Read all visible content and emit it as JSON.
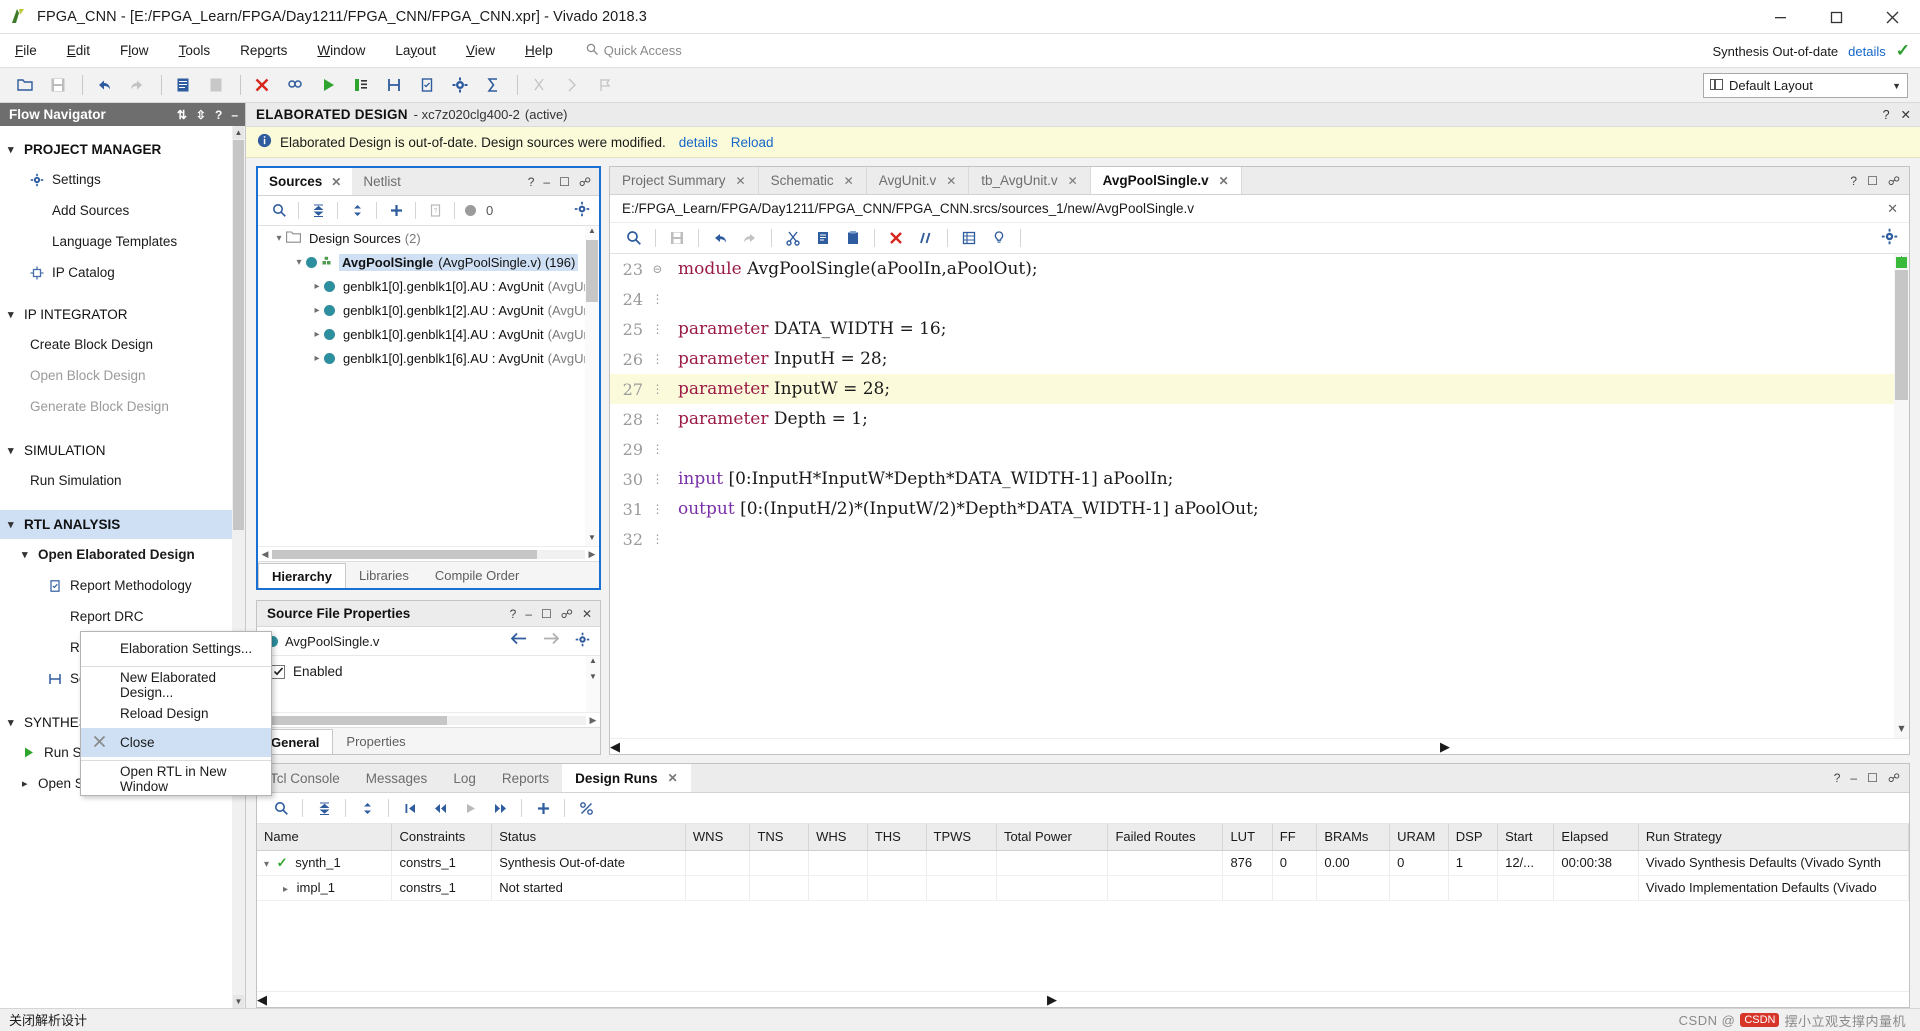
{
  "titlebar": {
    "title": "FPGA_CNN - [E:/FPGA_Learn/FPGA/Day1211/FPGA_CNN/FPGA_CNN.xpr] - Vivado 2018.3",
    "minimize": "minimize-icon",
    "maximize": "maximize-icon",
    "close": "close-icon"
  },
  "menubar": {
    "items": [
      "File",
      "Edit",
      "Flow",
      "Tools",
      "Reports",
      "Window",
      "Layout",
      "View",
      "Help"
    ],
    "quick_access_placeholder": "Quick Access",
    "sync_status": "Synthesis Out-of-date",
    "details_label": "details"
  },
  "toolbar": {
    "layout_value": "Default Layout"
  },
  "flow_navigator": {
    "header": "Flow Navigator",
    "sections": [
      {
        "label": "PROJECT MANAGER",
        "items": [
          {
            "label": "Settings",
            "icon": "gear-icon",
            "dim": false
          },
          {
            "label": "Add Sources",
            "icon": "",
            "dim": false
          },
          {
            "label": "Language Templates",
            "icon": "",
            "dim": false
          },
          {
            "label": "IP Catalog",
            "icon": "ip-icon",
            "dim": false
          }
        ]
      },
      {
        "label": "IP INTEGRATOR",
        "items": [
          {
            "label": "Create Block Design",
            "icon": "",
            "dim": false
          },
          {
            "label": "Open Block Design",
            "icon": "",
            "dim": true
          },
          {
            "label": "Generate Block Design",
            "icon": "",
            "dim": true
          }
        ]
      },
      {
        "label": "SIMULATION",
        "items": [
          {
            "label": "Run Simulation",
            "icon": "",
            "dim": false
          }
        ]
      },
      {
        "label": "RTL ANALYSIS",
        "active": true,
        "items": [
          {
            "label": "Open Elaborated Design",
            "icon": "",
            "dim": false,
            "bold": true
          },
          {
            "label": "Report Methodology",
            "icon": "clipboard-icon",
            "dim": false
          },
          {
            "label": "Report DRC",
            "icon": "",
            "dim": false
          },
          {
            "label": "Report Noise",
            "icon": "",
            "dim": false
          },
          {
            "label": "Schematic",
            "icon": "schematic-icon",
            "dim": false
          }
        ]
      },
      {
        "label": "SYNTHESIS",
        "items": [
          {
            "label": "Run Synthesis",
            "icon": "run-icon",
            "dim": false
          },
          {
            "label": "Open Synthesized Design",
            "icon": "",
            "dim": false
          }
        ]
      }
    ]
  },
  "context_menu": {
    "items": [
      {
        "label": "Elaboration Settings...",
        "icon": "",
        "selected": false,
        "sep_after": true
      },
      {
        "label": "New Elaborated Design...",
        "icon": "",
        "selected": false
      },
      {
        "label": "Reload Design",
        "icon": "",
        "selected": false
      },
      {
        "label": "Close",
        "icon": "close-x-icon",
        "selected": true,
        "sep_after": true
      },
      {
        "label": "Open RTL in New Window",
        "icon": "",
        "selected": false
      }
    ]
  },
  "design_header": {
    "title": "ELABORATED DESIGN",
    "subtitle": "- xc7z020clg400-2",
    "active": "(active)"
  },
  "warning_bar": {
    "message": "Elaborated Design is out-of-date. Design sources were modified.",
    "details_link": "details",
    "reload_link": "Reload"
  },
  "sources_panel": {
    "tabs": [
      {
        "label": "Sources",
        "active": true,
        "closable": true
      },
      {
        "label": "Netlist",
        "active": false,
        "closable": false
      }
    ],
    "toolbar_count": "0",
    "tree": [
      {
        "indent": 0,
        "chev": "v",
        "icon": "folder-icon",
        "name": "Design Sources",
        "meta": "(2)",
        "selected": false,
        "bold": false
      },
      {
        "indent": 1,
        "chev": "v",
        "icon": "module-icon",
        "name": "AvgPoolSingle",
        "meta": "(AvgPoolSingle.v) (196)",
        "selected": true,
        "bold": true
      },
      {
        "indent": 2,
        "chev": ">",
        "icon": "dot-icon",
        "name": "genblk1[0].genblk1[0].AU : AvgUnit",
        "meta": "(AvgUnit",
        "selected": false,
        "bold": false
      },
      {
        "indent": 2,
        "chev": ">",
        "icon": "dot-icon",
        "name": "genblk1[0].genblk1[2].AU : AvgUnit",
        "meta": "(AvgUnit",
        "selected": false,
        "bold": false
      },
      {
        "indent": 2,
        "chev": ">",
        "icon": "dot-icon",
        "name": "genblk1[0].genblk1[4].AU : AvgUnit",
        "meta": "(AvgUnit",
        "selected": false,
        "bold": false
      },
      {
        "indent": 2,
        "chev": ">",
        "icon": "dot-icon",
        "name": "genblk1[0].genblk1[6].AU : AvgUnit",
        "meta": "(AvgUnit",
        "selected": false,
        "bold": false
      }
    ],
    "bottom_tabs": [
      {
        "label": "Hierarchy",
        "active": true
      },
      {
        "label": "Libraries",
        "active": false
      },
      {
        "label": "Compile Order",
        "active": false
      }
    ]
  },
  "source_file_properties": {
    "title": "Source File Properties",
    "file_name": "AvgPoolSingle.v",
    "enabled_label": "Enabled",
    "enabled_checked": true,
    "tabs": [
      {
        "label": "General",
        "active": true
      },
      {
        "label": "Properties",
        "active": false
      }
    ]
  },
  "editor": {
    "tabs": [
      {
        "label": "Project Summary",
        "active": false,
        "closable": true
      },
      {
        "label": "Schematic",
        "active": false,
        "closable": true
      },
      {
        "label": "AvgUnit.v",
        "active": false,
        "closable": true
      },
      {
        "label": "tb_AvgUnit.v",
        "active": false,
        "closable": true
      },
      {
        "label": "AvgPoolSingle.v",
        "active": true,
        "closable": true
      }
    ],
    "file_path": "E:/FPGA_Learn/FPGA/Day1211/FPGA_CNN/FPGA_CNN.srcs/sources_1/new/AvgPoolSingle.v",
    "lines": [
      {
        "num": "23",
        "fold": true,
        "highlight": false,
        "tokens": [
          {
            "t": "module",
            "c": "kw"
          },
          {
            "t": " AvgPoolSingle(aPoolIn,aPoolOut);",
            "c": "idf"
          }
        ]
      },
      {
        "num": "24",
        "fold": false,
        "highlight": false,
        "tokens": []
      },
      {
        "num": "25",
        "fold": false,
        "highlight": false,
        "tokens": [
          {
            "t": "parameter",
            "c": "kw"
          },
          {
            "t": " DATA_WIDTH = 16;",
            "c": "idf"
          }
        ]
      },
      {
        "num": "26",
        "fold": false,
        "highlight": false,
        "tokens": [
          {
            "t": "parameter",
            "c": "kw"
          },
          {
            "t": " InputH = 28;",
            "c": "idf"
          }
        ]
      },
      {
        "num": "27",
        "fold": false,
        "highlight": true,
        "tokens": [
          {
            "t": "parameter",
            "c": "kw"
          },
          {
            "t": " InputW = 28;",
            "c": "idf"
          }
        ]
      },
      {
        "num": "28",
        "fold": false,
        "highlight": false,
        "tokens": [
          {
            "t": "parameter",
            "c": "kw"
          },
          {
            "t": " Depth = 1;",
            "c": "idf"
          }
        ]
      },
      {
        "num": "29",
        "fold": false,
        "highlight": false,
        "tokens": []
      },
      {
        "num": "30",
        "fold": false,
        "highlight": false,
        "tokens": [
          {
            "t": "input",
            "c": "kw2"
          },
          {
            "t": " [0:InputH*InputW*Depth*DATA_WIDTH-1] aPoolIn;",
            "c": "idf"
          }
        ]
      },
      {
        "num": "31",
        "fold": false,
        "highlight": false,
        "tokens": [
          {
            "t": "output",
            "c": "kw2"
          },
          {
            "t": " [0:(InputH/2)*(InputW/2)*Depth*DATA_WIDTH-1] aPoolOut;",
            "c": "idf"
          }
        ]
      },
      {
        "num": "32",
        "fold": false,
        "highlight": false,
        "tokens": []
      }
    ]
  },
  "bottom_dock": {
    "tabs": [
      {
        "label": "Tcl Console",
        "active": false,
        "closable": false
      },
      {
        "label": "Messages",
        "active": false,
        "closable": false
      },
      {
        "label": "Log",
        "active": false,
        "closable": false
      },
      {
        "label": "Reports",
        "active": false,
        "closable": false
      },
      {
        "label": "Design Runs",
        "active": true,
        "closable": true
      }
    ],
    "columns": [
      "Name",
      "Constraints",
      "Status",
      "WNS",
      "TNS",
      "WHS",
      "THS",
      "TPWS",
      "Total Power",
      "Failed Routes",
      "LUT",
      "FF",
      "BRAMs",
      "URAM",
      "DSP",
      "Start",
      "Elapsed",
      "Run Strategy"
    ],
    "rows": [
      {
        "expander": "v",
        "status_icon": "check-icon",
        "indent": 0,
        "cells": [
          "synth_1",
          "constrs_1",
          "Synthesis Out-of-date",
          "",
          "",
          "",
          "",
          "",
          "",
          "",
          "876",
          "0",
          "0.00",
          "0",
          "1",
          "12/...",
          "00:00:38",
          "Vivado Synthesis Defaults (Vivado Synth"
        ]
      },
      {
        "expander": ">",
        "status_icon": "",
        "indent": 1,
        "cells": [
          "impl_1",
          "constrs_1",
          "Not started",
          "",
          "",
          "",
          "",
          "",
          "",
          "",
          "",
          "",
          "",
          "",
          "",
          "",
          "",
          "Vivado Implementation Defaults (Vivado"
        ]
      }
    ]
  },
  "statusbar": {
    "message": "关闭解析设计",
    "watermark_prefix": "CSDN @",
    "watermark_text": "摆小立观支撑内量机"
  }
}
